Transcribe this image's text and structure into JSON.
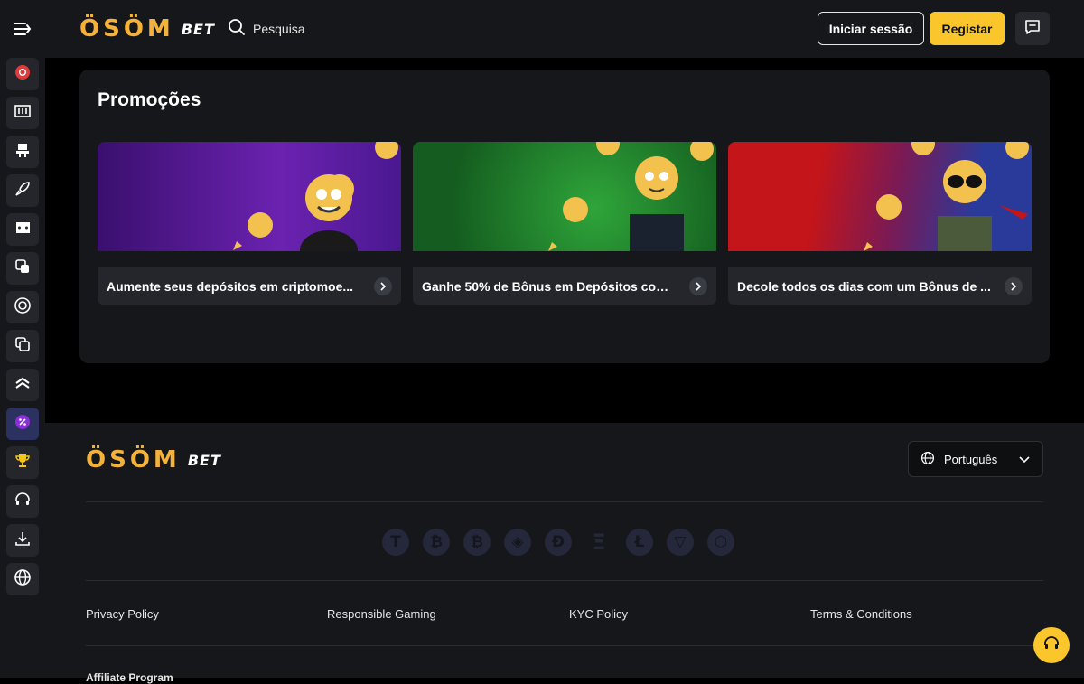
{
  "header": {
    "logo_text": "ÖSÖM",
    "logo_suffix": "BET",
    "search_placeholder": "Pesquisa",
    "login_label": "Iniciar sessão",
    "register_label": "Registar",
    "menu_icon": "menu-collapse-icon",
    "chat_icon": "chat-icon"
  },
  "sidebar": {
    "items": [
      {
        "icon": "casino-chip-icon",
        "active": false
      },
      {
        "icon": "slot-machine-icon",
        "active": false
      },
      {
        "icon": "live-dealer-icon",
        "active": false
      },
      {
        "icon": "rocket-icon",
        "active": false
      },
      {
        "icon": "cards-icon",
        "active": false
      },
      {
        "icon": "dice-icon",
        "active": false
      },
      {
        "icon": "roulette-icon",
        "active": false
      },
      {
        "icon": "copy-icon",
        "active": false
      },
      {
        "icon": "chevrons-up-icon",
        "active": false
      },
      {
        "icon": "percent-promo-icon",
        "active": true
      },
      {
        "icon": "trophy-icon",
        "active": false
      },
      {
        "icon": "headset-icon",
        "active": false
      },
      {
        "icon": "download-icon",
        "active": false
      },
      {
        "icon": "globe-icon",
        "active": false
      }
    ]
  },
  "promotions": {
    "title": "Promoções",
    "cards": [
      {
        "label": "Aumente seus depósitos em criptomoe...",
        "bg": "#5a1b8f"
      },
      {
        "label": "Ganhe 50% de Bônus em Depósitos com...",
        "bg": "#1f7a2c"
      },
      {
        "label": "Decole todos os dias com um Bônus de ...",
        "bg": "#b3141a"
      }
    ]
  },
  "footer": {
    "logo_text": "ÖSÖM",
    "logo_suffix": "BET",
    "language": "Português",
    "coins": [
      "T",
      "₿",
      "₿",
      "◈",
      "Đ",
      "Ξ",
      "Ł",
      "▽",
      "⬡"
    ],
    "links": [
      "Privacy Policy",
      "Responsible Gaming",
      "KYC Policy",
      "Terms & Conditions"
    ],
    "affiliate": "Affiliate Program"
  },
  "colors": {
    "accent": "#fbc62c",
    "logo": "#f5b23a",
    "panel": "#16171a",
    "background": "#000000"
  }
}
